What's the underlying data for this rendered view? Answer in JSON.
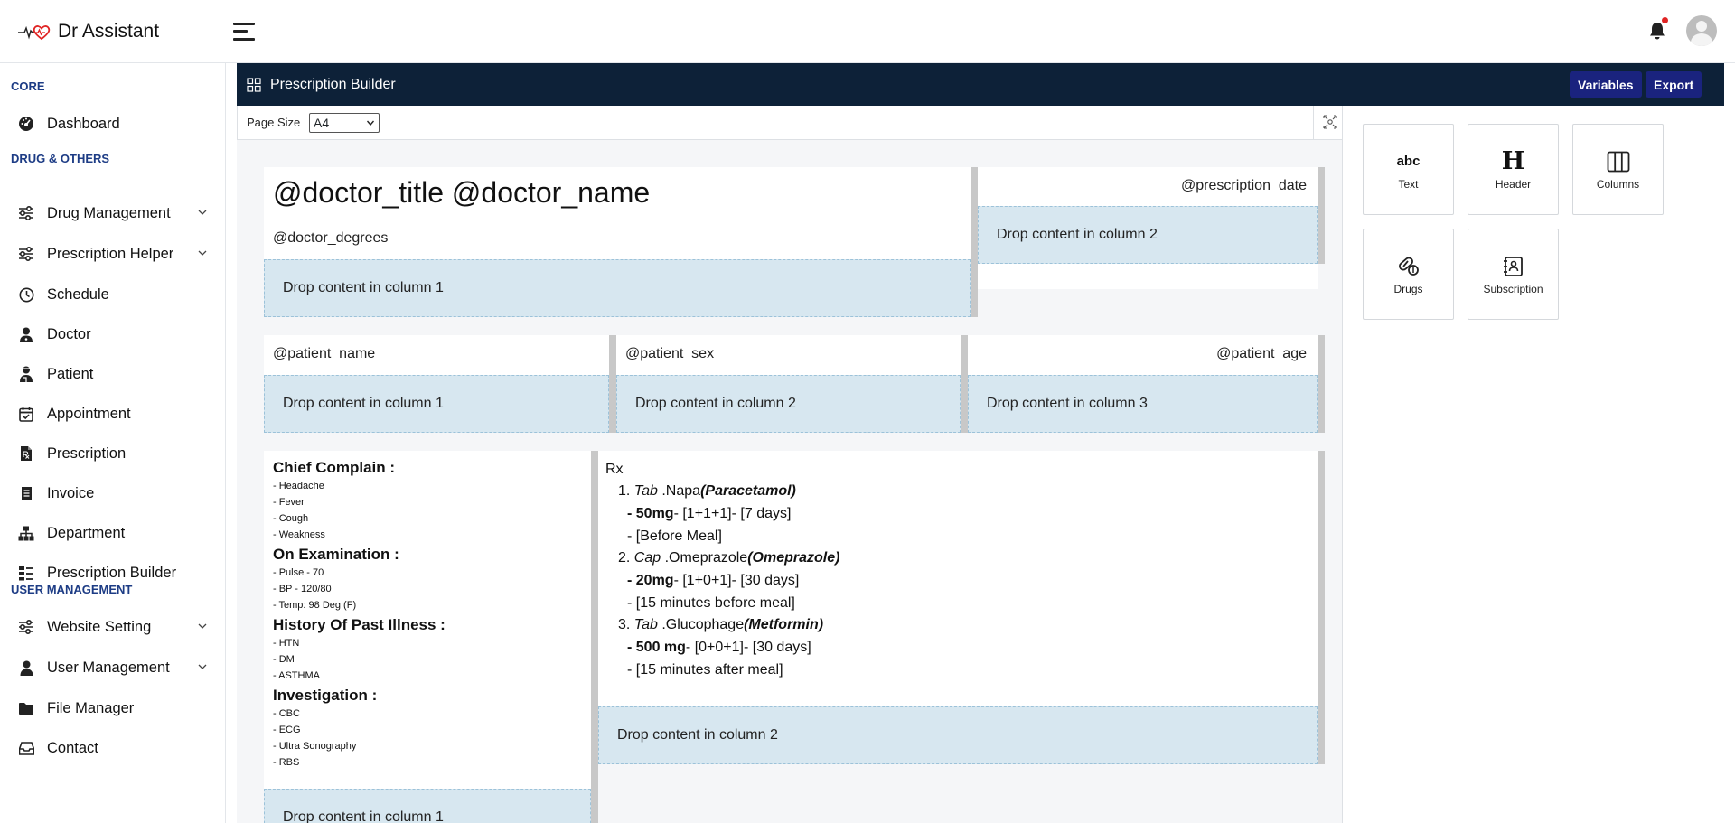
{
  "brand": {
    "name": "Dr Assistant"
  },
  "sidebar": {
    "sections": [
      {
        "title": "CORE"
      },
      {
        "title": "DRUG & OTHERS"
      },
      {
        "title": "USER MANAGEMENT"
      }
    ],
    "items": [
      {
        "label": "Dashboard",
        "icon": "gauge-icon"
      },
      {
        "label": "Drug Management",
        "icon": "sliders-icon",
        "expandable": true
      },
      {
        "label": "Prescription Helper",
        "icon": "sliders-icon",
        "expandable": true
      },
      {
        "label": "Schedule",
        "icon": "clock-icon"
      },
      {
        "label": "Doctor",
        "icon": "user-doctor-icon"
      },
      {
        "label": "Patient",
        "icon": "user-injured-icon"
      },
      {
        "label": "Appointment",
        "icon": "calendar-check-icon"
      },
      {
        "label": "Prescription",
        "icon": "file-prescription-icon"
      },
      {
        "label": "Invoice",
        "icon": "receipt-icon"
      },
      {
        "label": "Department",
        "icon": "sitemap-icon"
      },
      {
        "label": "Prescription Builder",
        "icon": "builder-icon"
      },
      {
        "label": "Website Setting",
        "icon": "sliders-icon",
        "expandable": true
      },
      {
        "label": "User Management",
        "icon": "user-icon",
        "expandable": true
      },
      {
        "label": "File Manager",
        "icon": "folder-icon"
      },
      {
        "label": "Contact",
        "icon": "inbox-icon"
      }
    ]
  },
  "builder": {
    "title": "Prescription Builder",
    "variables_label": "Variables",
    "export_label": "Export",
    "page_size_label": "Page Size",
    "page_size_value": "A4"
  },
  "palette": [
    {
      "label": "Text",
      "icon": "text-abc-icon",
      "glyph": "abc"
    },
    {
      "label": "Header",
      "icon": "header-icon",
      "glyph": "H"
    },
    {
      "label": "Columns",
      "icon": "columns-icon"
    },
    {
      "label": "Drugs",
      "icon": "pills-icon"
    },
    {
      "label": "Subscription",
      "icon": "subscription-icon"
    }
  ],
  "canvas": {
    "row1": {
      "doctor_title": "@doctor_title @doctor_name",
      "doctor_degrees": "@doctor_degrees",
      "prescription_date": "@prescription_date",
      "drop1": "Drop content in column 1",
      "drop2": "Drop content in column 2"
    },
    "row2": {
      "patient_name": "@patient_name",
      "patient_sex": "@patient_sex",
      "patient_age": "@patient_age",
      "drop1": "Drop content in column 1",
      "drop2": "Drop content in column 2",
      "drop3": "Drop content in column 3"
    },
    "row3": {
      "sections": [
        {
          "heading": "Chief Complain :",
          "items": [
            "- Headache",
            "- Fever",
            "- Cough",
            "- Weakness"
          ]
        },
        {
          "heading": "On Examination :",
          "items": [
            "- Pulse - 70",
            "- BP - 120/80",
            "- Temp: 98 Deg (F)"
          ]
        },
        {
          "heading": "History Of Past Illness :",
          "items": [
            "- HTN",
            "- DM",
            "- ASTHMA"
          ]
        },
        {
          "heading": "Investigation :",
          "items": [
            "- CBC",
            "- ECG",
            "- Ultra Sonography",
            "- RBS"
          ]
        }
      ],
      "rx_label": "Rx",
      "drugs": [
        {
          "num": "1.",
          "form": "Tab",
          "name": ".Napa",
          "generic": "(Paracetamol)",
          "dose": "- 50mg",
          "schedule": "- [1+1+1]- [7 days]",
          "note": "- [Before Meal]"
        },
        {
          "num": "2.",
          "form": "Cap",
          "name": ".Omeprazole",
          "generic": "(Omeprazole)",
          "dose": "- 20mg",
          "schedule": "- [1+0+1]- [30 days]",
          "note": "- [15 minutes before meal]"
        },
        {
          "num": "3.",
          "form": "Tab",
          "name": ".Glucophage",
          "generic": "(Metformin)",
          "dose": "- 500 mg",
          "schedule": "- [0+0+1]- [30 days]",
          "note": "- [15 minutes after meal]"
        }
      ],
      "drop1": "Drop content in column 1",
      "drop2": "Drop content in column 2"
    }
  }
}
